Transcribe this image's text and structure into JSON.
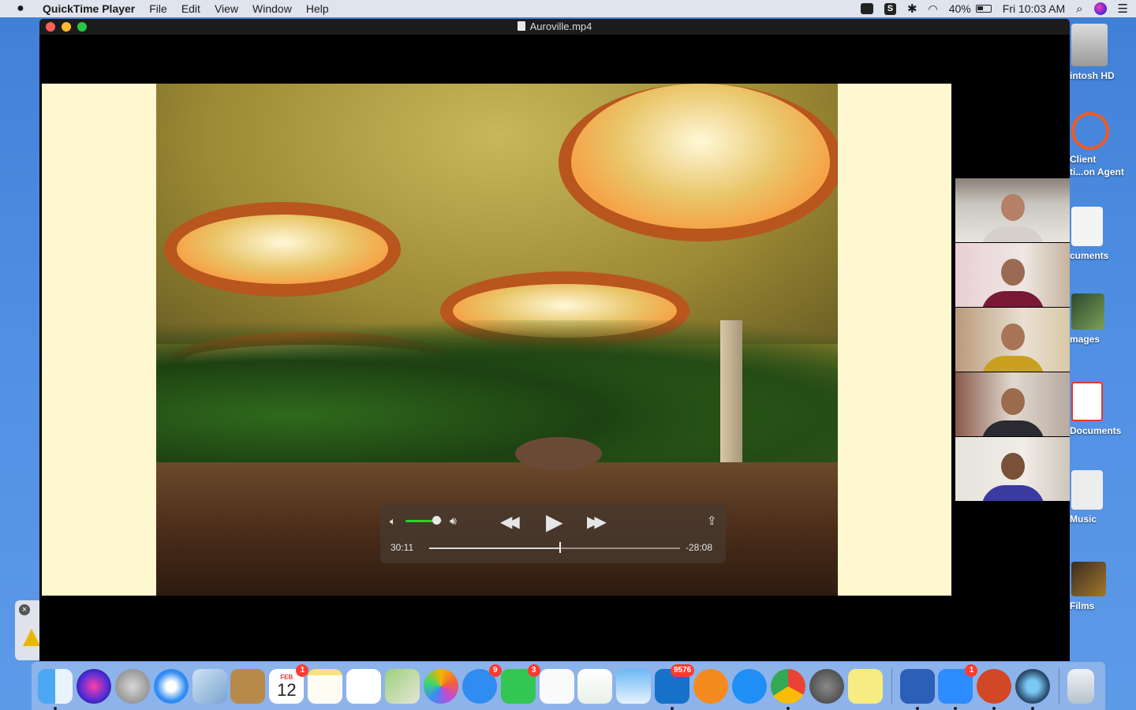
{
  "menubar": {
    "app_name": "QuickTime Player",
    "menus": [
      "File",
      "Edit",
      "View",
      "Window",
      "Help"
    ],
    "battery": "40%",
    "clock": "Fri 10:03 AM"
  },
  "window": {
    "title": "Auroville.mp4"
  },
  "player": {
    "elapsed": "30:11",
    "remaining": "-28:08",
    "progress_fraction": 0.52,
    "volume_fraction": 0.85
  },
  "desktop_icons": [
    {
      "label": "intosh HD",
      "icon": "hard-drive-icon"
    },
    {
      "label": "Client",
      "label2": "ti...on Agent",
      "icon": "client-agent-icon"
    },
    {
      "label": "cuments",
      "icon": "docx-icon"
    },
    {
      "label": "mages",
      "icon": "images-folder-icon"
    },
    {
      "label": "Documents",
      "icon": "pdf-icon"
    },
    {
      "label": "Music",
      "icon": "music-icon"
    },
    {
      "label": "Films",
      "icon": "films-icon"
    }
  ],
  "dock": {
    "calendar_month": "FEB",
    "calendar_day": "12",
    "badges": {
      "calendar": "1",
      "messages": "9",
      "facetime": "3",
      "outlook": "9576",
      "zoom": "1"
    }
  },
  "colors": {
    "accent_green": "#27d52b",
    "badge_red": "#ff3b30",
    "desktop_blue": "#4f8fe3"
  }
}
